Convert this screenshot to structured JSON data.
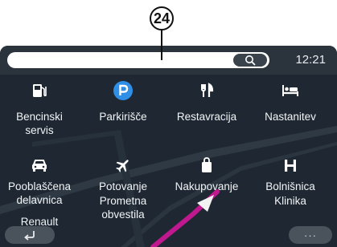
{
  "callout": {
    "number": "24"
  },
  "status": {
    "clock": "12:21"
  },
  "search": {
    "placeholder": "",
    "value": ""
  },
  "poi": [
    {
      "label": "Bencinski",
      "sub": "servis",
      "icon": "fuel-pump-icon"
    },
    {
      "label": "Parkirišče",
      "sub": "",
      "icon": "parking-icon"
    },
    {
      "label": "Restavracija",
      "sub": "",
      "icon": "fork-knife-icon"
    },
    {
      "label": "Nastanitev",
      "sub": "",
      "icon": "bed-icon"
    },
    {
      "label": "Pooblaščena",
      "sub": "delavnica",
      "icon": "car-icon"
    },
    {
      "label": "Potovanje",
      "sub": "Prometna obvestila",
      "icon": "airplane-icon"
    },
    {
      "label": "Nakupovanje",
      "sub": "",
      "icon": "shopping-bag-icon"
    },
    {
      "label": "Bolnišnica",
      "sub": "Klinika",
      "icon": "hospital-icon"
    }
  ],
  "extra_label": "Renault",
  "buttons": {
    "back_icon": "back-arrow-icon",
    "more_label": "···"
  },
  "colors": {
    "screen_bg": "#1f2832",
    "topbar_bg": "#2b333d",
    "parking_blue": "#2f8ee6",
    "route_magenta": "#c0188f"
  }
}
